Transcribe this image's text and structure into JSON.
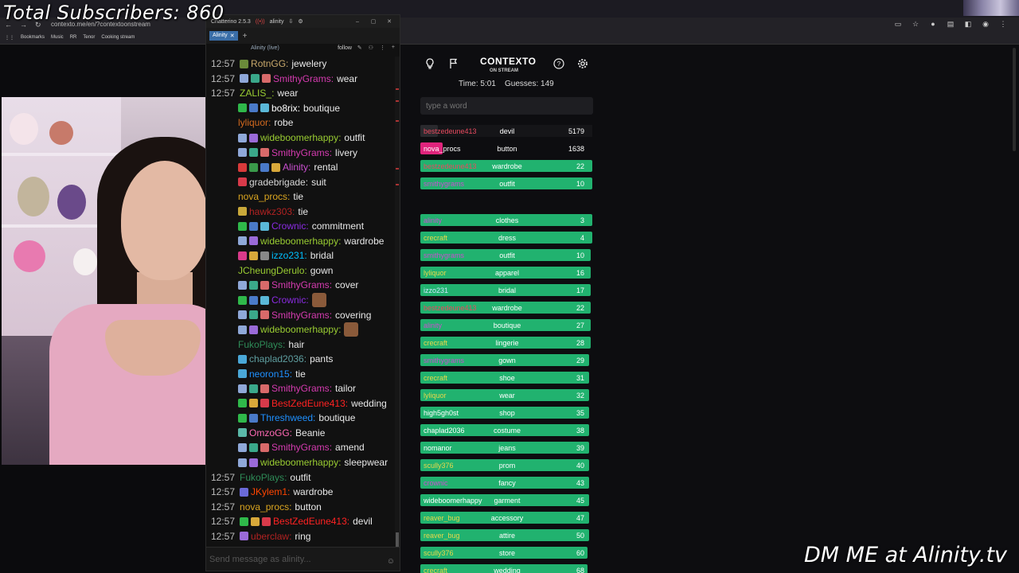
{
  "overlay": {
    "subscribers": "Total Subscribers: 860",
    "dm": "DM ME at Alinity.tv"
  },
  "browser": {
    "url": "contexto.me/en/?contextoonstream",
    "bookmarks": [
      "Bookmarks",
      "Music",
      "RR",
      "Tenor",
      "Cooking stream"
    ]
  },
  "chatterino": {
    "title": "Chatterino 2.5.3",
    "channel_name": "alinity",
    "tab_label": "Alinity",
    "live_label": "Alinity (live)",
    "follow_label": "follow",
    "input_placeholder": "Send message as alinity...",
    "messages": [
      {
        "time": "12:57",
        "user": "RotnGG",
        "color": "#c8a86b",
        "text": "jewelery",
        "badges": [
          "#6a8a3a"
        ]
      },
      {
        "time": "12:57",
        "user": "SmithyGrams",
        "color": "#d53bb0",
        "text": "wear",
        "badges": [
          "#8fa8d8",
          "#3aa88a",
          "#d86a6a"
        ]
      },
      {
        "time": "12:57",
        "user": "ZALIS_",
        "color": "#9acd32",
        "text": "wear",
        "badges": []
      },
      {
        "time": "",
        "user": "bo8rix",
        "color": "#ffffff",
        "text": "boutique",
        "badges": [
          "#2fb84a",
          "#4a7ac8",
          "#5ab8d8"
        ],
        "cut": true
      },
      {
        "time": "",
        "user": "lyliquor",
        "color": "#d2691e",
        "text": "robe",
        "badges": [],
        "cut": true
      },
      {
        "time": "",
        "user": "wideboomerhappy",
        "color": "#9acd32",
        "text": "outfit",
        "badges": [
          "#8fa8d8",
          "#9a6ad8"
        ],
        "cut": true
      },
      {
        "time": "",
        "user": "SmithyGrams",
        "color": "#d53bb0",
        "text": "livery",
        "badges": [
          "#8fa8d8",
          "#3aa88a",
          "#d86a6a"
        ],
        "cut": true
      },
      {
        "time": "",
        "user": "Alinity",
        "color": "#c94fcf",
        "text": "rental",
        "badges": [
          "#d83a3a",
          "#3a9a4a",
          "#4a7ac8",
          "#d8a83a"
        ],
        "cut": true
      },
      {
        "time": "",
        "user": "gradebrigade",
        "color": "#d8d8d8",
        "text": "suit",
        "badges": [
          "#d83a4a"
        ],
        "cut": true
      },
      {
        "time": "",
        "user": "nova_procs",
        "color": "#daa520",
        "text": "tie",
        "badges": [],
        "cut": true
      },
      {
        "time": "",
        "user": "hawkz303",
        "color": "#b22222",
        "text": "tie",
        "badges": [
          "#c8a83a"
        ],
        "cut": true
      },
      {
        "time": "",
        "user": "Crownic",
        "color": "#8a2be2",
        "text": "commitment",
        "badges": [
          "#2fb84a",
          "#4a7ac8",
          "#5ab8d8"
        ],
        "cut": true
      },
      {
        "time": "",
        "user": "wideboomerhappy",
        "color": "#9acd32",
        "text": "wardrobe",
        "badges": [
          "#8fa8d8",
          "#9a6ad8"
        ],
        "cut": true
      },
      {
        "time": "",
        "user": "izzo231",
        "color": "#00bfff",
        "text": "bridal",
        "badges": [
          "#d83a8a",
          "#d8a83a",
          "#888888"
        ],
        "cut": true
      },
      {
        "time": "",
        "user": "JCheungDerulo",
        "color": "#9acd32",
        "text": "gown",
        "badges": [],
        "cut": true
      },
      {
        "time": "",
        "user": "SmithyGrams",
        "color": "#d53bb0",
        "text": "cover",
        "badges": [
          "#8fa8d8",
          "#3aa88a",
          "#d86a6a"
        ],
        "cut": true
      },
      {
        "time": "",
        "user": "Crownic",
        "color": "#8a2be2",
        "text": "",
        "emote": true,
        "badges": [
          "#2fb84a",
          "#4a7ac8",
          "#5ab8d8"
        ],
        "cut": true
      },
      {
        "time": "",
        "user": "SmithyGrams",
        "color": "#d53bb0",
        "text": "covering",
        "badges": [
          "#8fa8d8",
          "#3aa88a",
          "#d86a6a"
        ],
        "cut": true
      },
      {
        "time": "",
        "user": "wideboomerhappy",
        "color": "#9acd32",
        "text": "",
        "emote": true,
        "badges": [
          "#8fa8d8",
          "#9a6ad8"
        ],
        "cut": true
      },
      {
        "time": "",
        "user": "FukoPlays",
        "color": "#2e8b57",
        "text": "hair",
        "badges": [],
        "cut": true
      },
      {
        "time": "",
        "user": "chaplad2036",
        "color": "#5f9ea0",
        "text": "pants",
        "badges": [
          "#4aa8d8"
        ],
        "cut": true
      },
      {
        "time": "",
        "user": "neoron15",
        "color": "#1e90ff",
        "text": "tie",
        "badges": [
          "#4aa8d8"
        ],
        "cut": true
      },
      {
        "time": "",
        "user": "SmithyGrams",
        "color": "#d53bb0",
        "text": "tailor",
        "badges": [
          "#8fa8d8",
          "#3aa88a",
          "#d86a6a"
        ],
        "cut": true
      },
      {
        "time": "",
        "user": "BestZedEune413",
        "color": "#ff2222",
        "text": "wedding",
        "badges": [
          "#2fb84a",
          "#d8a83a",
          "#d83a4a"
        ],
        "cut": true
      },
      {
        "time": "",
        "user": "Threshweed",
        "color": "#1e90ff",
        "text": "boutique",
        "badges": [
          "#2fb84a",
          "#4a7ac8"
        ],
        "cut": true
      },
      {
        "time": "",
        "user": "OmzoGG",
        "color": "#ff69b4",
        "text": "Beanie",
        "badges": [
          "#5ab8a8"
        ],
        "cut": true
      },
      {
        "time": "",
        "user": "SmithyGrams",
        "color": "#d53bb0",
        "text": "amend",
        "badges": [
          "#8fa8d8",
          "#3aa88a",
          "#d86a6a"
        ],
        "cut": true
      },
      {
        "time": "",
        "user": "wideboomerhappy",
        "color": "#9acd32",
        "text": "sleepwear",
        "badges": [
          "#8fa8d8",
          "#9a6ad8"
        ],
        "cut": true
      },
      {
        "time": "12:57",
        "user": "FukoPlays",
        "color": "#2e8b57",
        "text": "outfit",
        "badges": []
      },
      {
        "time": "12:57",
        "user": "JKylem1",
        "color": "#ff4500",
        "text": "wardrobe",
        "badges": [
          "#6a6ad8"
        ]
      },
      {
        "time": "12:57",
        "user": "nova_procs",
        "color": "#daa520",
        "text": "button",
        "badges": []
      },
      {
        "time": "12:57",
        "user": "BestZedEune413",
        "color": "#ff2222",
        "text": "devil",
        "badges": [
          "#2fb84a",
          "#d8a83a",
          "#d83a4a"
        ]
      },
      {
        "time": "12:57",
        "user": "uberclaw",
        "color": "#b22222",
        "text": "ring",
        "badges": [
          "#9a6ad8"
        ]
      }
    ]
  },
  "contexto": {
    "title": "CONTEXTO",
    "subtitle": "ON STREAM",
    "time": "Time: 5:01",
    "guesses": "Guesses: 149",
    "input_placeholder": "type a word",
    "colors": {
      "green": "#21b26f",
      "red": "#e84a5f",
      "pink": "#e0247c",
      "dim": "#2a2a2e"
    },
    "recent": [
      {
        "player": "bestzedeune413",
        "word": "devil",
        "rank": "5179",
        "color": "dim",
        "player_color": "#e84a5f",
        "fill": 0.1
      },
      {
        "player": "nova_procs",
        "word": "button",
        "rank": "1638",
        "color": "pink",
        "player_color": "#ffffff",
        "fill": 0.13
      },
      {
        "player": "bestzedeune413",
        "word": "wardrobe",
        "rank": "22",
        "color": "green",
        "player_color": "#e84a5f",
        "fill": 1.0
      },
      {
        "player": "smithygrams",
        "word": "outfit",
        "rank": "10",
        "color": "green",
        "player_color": "#c94fcf",
        "fill": 1.0
      }
    ],
    "ranked": [
      {
        "player": "alinity",
        "word": "clothes",
        "rank": "3",
        "player_color": "#c94fcf",
        "fill": 1.0
      },
      {
        "player": "crecraft",
        "word": "dress",
        "rank": "4",
        "player_color": "#e8d84a",
        "fill": 1.0
      },
      {
        "player": "smithygrams",
        "word": "outfit",
        "rank": "10",
        "player_color": "#c94fcf",
        "fill": 0.99
      },
      {
        "player": "lyliquor",
        "word": "apparel",
        "rank": "16",
        "player_color": "#e8d84a",
        "fill": 0.99
      },
      {
        "player": "izzo231",
        "word": "bridal",
        "rank": "17",
        "player_color": "#cfe8ff",
        "fill": 0.99
      },
      {
        "player": "bestzedeune413",
        "word": "wardrobe",
        "rank": "22",
        "player_color": "#e84a5f",
        "fill": 0.99
      },
      {
        "player": "alinity",
        "word": "boutique",
        "rank": "27",
        "player_color": "#c94fcf",
        "fill": 0.99
      },
      {
        "player": "crecraft",
        "word": "lingerie",
        "rank": "28",
        "player_color": "#e8d84a",
        "fill": 0.99
      },
      {
        "player": "smithygrams",
        "word": "gown",
        "rank": "29",
        "player_color": "#c94fcf",
        "fill": 0.98
      },
      {
        "player": "crecraft",
        "word": "shoe",
        "rank": "31",
        "player_color": "#e8d84a",
        "fill": 0.98
      },
      {
        "player": "lyliquor",
        "word": "wear",
        "rank": "32",
        "player_color": "#e8d84a",
        "fill": 0.98
      },
      {
        "player": "high5gh0st",
        "word": "shop",
        "rank": "35",
        "player_color": "#ffffff",
        "fill": 0.98
      },
      {
        "player": "chaplad2036",
        "word": "costume",
        "rank": "38",
        "player_color": "#ffffff",
        "fill": 0.98
      },
      {
        "player": "nomanor",
        "word": "jeans",
        "rank": "39",
        "player_color": "#ffffff",
        "fill": 0.98
      },
      {
        "player": "scully376",
        "word": "prom",
        "rank": "40",
        "player_color": "#e8d84a",
        "fill": 0.98
      },
      {
        "player": "crownic",
        "word": "fancy",
        "rank": "43",
        "player_color": "#c94fcf",
        "fill": 0.98
      },
      {
        "player": "wideboomerhappy",
        "word": "garment",
        "rank": "45",
        "player_color": "#ffffff",
        "fill": 0.98
      },
      {
        "player": "reaver_bug",
        "word": "accessory",
        "rank": "47",
        "player_color": "#e8d84a",
        "fill": 0.98
      },
      {
        "player": "reaver_bug",
        "word": "attire",
        "rank": "50",
        "player_color": "#e8d84a",
        "fill": 0.98
      },
      {
        "player": "scully376",
        "word": "store",
        "rank": "60",
        "player_color": "#e8d84a",
        "fill": 0.97
      },
      {
        "player": "crecraft",
        "word": "wedding",
        "rank": "68",
        "player_color": "#e8d84a",
        "fill": 0.97
      }
    ]
  }
}
